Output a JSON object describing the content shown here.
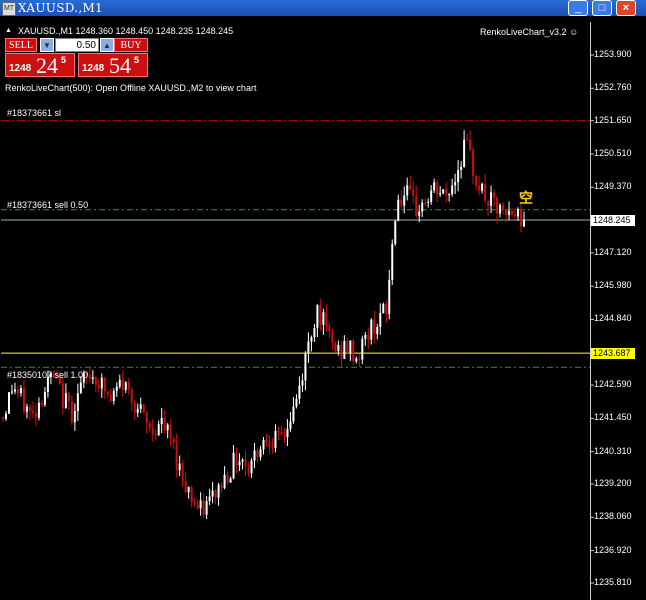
{
  "window": {
    "title": "XAUUSD.,M1",
    "icon": "app-window-icon",
    "buttons": {
      "minimize": "_",
      "maximize": "□",
      "close": "×"
    }
  },
  "chart_header": {
    "info": "XAUUSD.,M1  1248.360 1248.450 1248.235 1248.245",
    "indicator": "RenkoLiveChart_v3.2 ☺"
  },
  "trade_panel": {
    "sell_label": "SELL",
    "buy_label": "BUY",
    "lot_value": "0.50",
    "down_arrow": "▼",
    "up_arrow": "▲",
    "sell_price": {
      "small": "1248",
      "big": "24",
      "sup": "5"
    },
    "buy_price": {
      "small": "1248",
      "big": "54",
      "sup": "5"
    }
  },
  "renko_message": "RenkoLiveChart(500): Open Offline XAUUSD.,M2 to view chart",
  "order_lines": {
    "sl_label": "#18373661 sl",
    "order1_label": "#18373661 sell 0.50",
    "order2_label": "#18350107 sell 1.00"
  },
  "marker_text": "空",
  "price_axis": {
    "ticks": [
      "1253.900",
      "1252.760",
      "1251.650",
      "1250.510",
      "1249.370",
      "1248.245",
      "1247.120",
      "1245.980",
      "1244.840",
      "1243.687",
      "1242.590",
      "1241.450",
      "1240.310",
      "1239.200",
      "1238.060",
      "1236.920",
      "1235.810"
    ],
    "current_price_tag": "1248.245",
    "hline_price_tag": "1243.687"
  },
  "colors": {
    "up_candle": "#ffffff",
    "down_candle": "#cc1010",
    "sl_line": "#cc0000",
    "order_line": "#3c8c3c",
    "hline": "#ffff00",
    "bid_line": "#a0b8a0",
    "marker": "#ffcc00"
  },
  "chart_data": {
    "type": "candlestick",
    "symbol": "XAUUSD.",
    "timeframe": "M1",
    "ylim": [
      1235.81,
      1253.9
    ],
    "close_path": [
      1241.5,
      1242.6,
      1242.0,
      1241.5,
      1242.3,
      1242.9,
      1242.2,
      1241.7,
      1242.6,
      1243.0,
      1242.6,
      1242.0,
      1242.7,
      1242.3,
      1241.6,
      1241.0,
      1241.3,
      1240.8,
      1239.7,
      1238.9,
      1238.2,
      1238.6,
      1239.1,
      1239.7,
      1240.2,
      1239.8,
      1240.5,
      1240.9,
      1240.6,
      1241.2,
      1242.2,
      1243.9,
      1245.3,
      1244.3,
      1243.7,
      1243.9,
      1243.5,
      1244.3,
      1244.8,
      1245.1,
      1248.9,
      1249.1,
      1248.6,
      1248.9,
      1249.3,
      1249.0,
      1249.7,
      1250.9,
      1249.8,
      1249.0,
      1248.7,
      1248.3,
      1248.5,
      1248.245
    ],
    "horizontal_lines": [
      {
        "label": "#18373661 sl",
        "price": 1251.65
      },
      {
        "label": "#18373661 sell 0.50",
        "price": 1248.6
      },
      {
        "label": "#18350107 sell 1.00",
        "price": 1243.2
      },
      {
        "label": "",
        "price": 1243.687
      },
      {
        "label": "",
        "price": 1248.245
      }
    ]
  }
}
